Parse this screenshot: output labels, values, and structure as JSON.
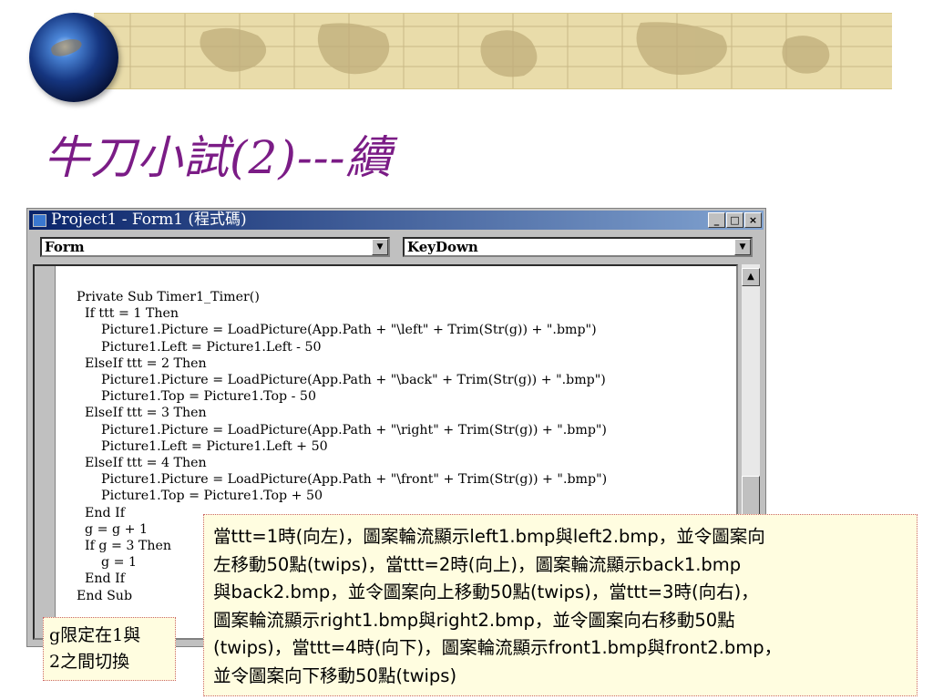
{
  "slide": {
    "title": "牛刀小試(2)---續"
  },
  "window": {
    "title": "Project1 - Form1 (程式碼)",
    "buttons": {
      "minimize": "_",
      "maximize": "□",
      "close": "×"
    },
    "object_combo": "Form",
    "procedure_combo": "KeyDown",
    "code_lines": [
      "Private Sub Timer1_Timer()",
      "  If ttt = 1 Then",
      "      Picture1.Picture = LoadPicture(App.Path + \"\\left\" + Trim(Str(g)) + \".bmp\")",
      "      Picture1.Left = Picture1.Left - 50",
      "  ElseIf ttt = 2 Then",
      "      Picture1.Picture = LoadPicture(App.Path + \"\\back\" + Trim(Str(g)) + \".bmp\")",
      "      Picture1.Top = Picture1.Top - 50",
      "  ElseIf ttt = 3 Then",
      "      Picture1.Picture = LoadPicture(App.Path + \"\\right\" + Trim(Str(g)) + \".bmp\")",
      "      Picture1.Left = Picture1.Left + 50",
      "  ElseIf ttt = 4 Then",
      "      Picture1.Picture = LoadPicture(App.Path + \"\\front\" + Trim(Str(g)) + \".bmp\")",
      "      Picture1.Top = Picture1.Top + 50",
      "  End If",
      "  g = g + 1",
      "  If g = 3 Then",
      "      g = 1",
      "  End If",
      "End Sub"
    ]
  },
  "callout_main": [
    "當ttt=1時(向左)，圖案輪流顯示left1.bmp與left2.bmp，並令圖案向",
    "左移動50點(twips)，當ttt=2時(向上)，圖案輪流顯示back1.bmp",
    "與back2.bmp，並令圖案向上移動50點(twips)，當ttt=3時(向右)，",
    "圖案輪流顯示right1.bmp與right2.bmp，並令圖案向右移動50點",
    "(twips)，當ttt=4時(向下)，圖案輪流顯示front1.bmp與front2.bmp，",
    "並令圖案向下移動50點(twips)"
  ],
  "callout_side": [
    "g限定在1與",
    "2之間切換"
  ],
  "colors": {
    "title": "#7b1c86",
    "banner": "#e9dcaa",
    "callout_bg": "#fffde0",
    "titlebar": "#0a246a"
  },
  "icons": [
    "globe-icon",
    "window-icon",
    "dropdown-arrow-icon",
    "scroll-up-icon"
  ]
}
